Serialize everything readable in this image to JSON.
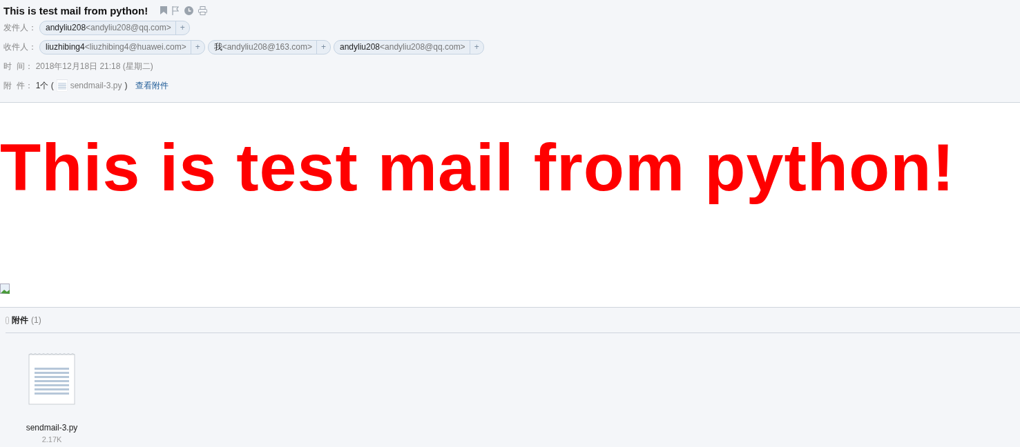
{
  "subject": "This is test mail from python!",
  "header_fields": [
    {
      "kind": "contacts",
      "label": "发件人：",
      "contacts": [
        {
          "name": "andyliu208",
          "address": "<andyliu208@qq.com>",
          "add": "+"
        }
      ]
    },
    {
      "kind": "contacts",
      "label": "收件人：",
      "contacts": [
        {
          "name": "liuzhibing4",
          "address": "<liuzhibing4@huawei.com>",
          "add": "+"
        },
        {
          "name": "我",
          "address": "<andyliu208@163.com>",
          "add": "+"
        },
        {
          "name": "andyliu208",
          "address": "<andyliu208@qq.com>",
          "add": "+"
        }
      ]
    },
    {
      "kind": "text",
      "label": "时  间：",
      "value": "2018年12月18日 21:18 (星期二)"
    },
    {
      "kind": "attachment",
      "label": "附  件：",
      "count": "1个 (",
      "file": "sendmail-3.py",
      "close": ")",
      "link": "查看附件"
    }
  ],
  "body": {
    "text": "This is test mail from python!"
  },
  "attachments": {
    "title": "附件",
    "count": "(1)",
    "files": [
      {
        "name": "sendmail-3.py",
        "size": "2.17K"
      }
    ]
  }
}
